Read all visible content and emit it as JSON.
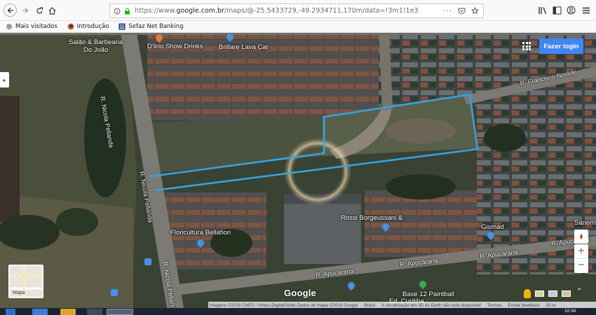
{
  "browser": {
    "url_prefix": "https://www.",
    "url_domain": "google.com.br",
    "url_path": "/maps/@-25.5433729,-49.2934711,170m/data=!3m1!1e3",
    "bookmarks": [
      {
        "label": "Mais visitados",
        "icon": "gear-icon",
        "color": "#2b2b2b"
      },
      {
        "label": "Introdução",
        "icon": "firefox-icon",
        "color": "#e66000"
      },
      {
        "label": "Sefaz Net Banking",
        "icon": "bank-icon",
        "color": "#1c3e7a"
      }
    ]
  },
  "map": {
    "login_label": "Fazer login",
    "places": [
      {
        "label": "Salão & Barbearia\nDo João"
      },
      {
        "label": "D'lirio Show Drinks"
      },
      {
        "label": "Brillare Lava Car"
      },
      {
        "label": "Floricultura Bellafiori"
      },
      {
        "label": "Rossi Borgeussani &"
      },
      {
        "label": "Gismad"
      },
      {
        "label": "Sanemi"
      },
      {
        "label": "Base 12 Paintball"
      },
      {
        "label": "Ed. Curitiba"
      }
    ],
    "streets": [
      {
        "label": "R. Nicola Pellanda"
      },
      {
        "label": "R. Nicola Pellanda"
      },
      {
        "label": "R. Nicola Pellanda"
      },
      {
        "label": "R. Francisco Novicki"
      },
      {
        "label": "R. Apucarana"
      },
      {
        "label": "R. Apucarana"
      },
      {
        "label": "R. Apucarana"
      },
      {
        "label": "R. Apucarana"
      }
    ],
    "minimap_label": "Mapa",
    "google_logo": "Google",
    "attribution": [
      "Imagens ©2018 CNES / Airbus,DigitalGlobe,Dados do mapa ©2018 Google",
      "Brasil",
      "A visualização em 3D do Earth não está disponível",
      "Termos",
      "Enviar feedback",
      "20 m"
    ],
    "zoom_in": "+",
    "zoom_out": "−",
    "overlay_color": "#36a3e0"
  },
  "taskbar": {
    "clock": "10:34"
  }
}
